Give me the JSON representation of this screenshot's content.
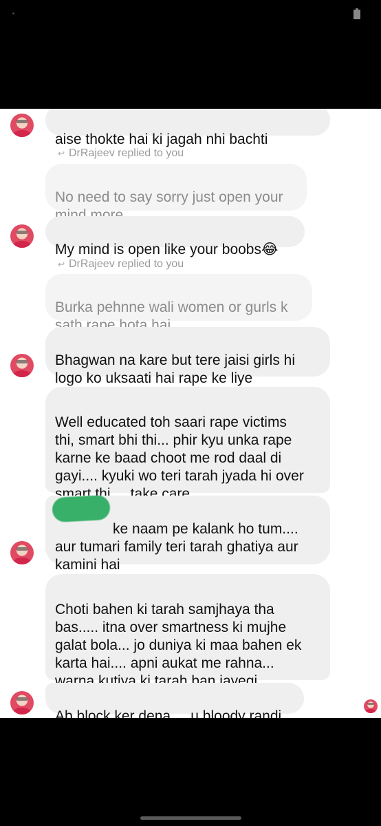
{
  "conversation": {
    "other_user": "DrRajeev",
    "reply_labels": [
      "DrRajeev replied to you",
      "DrRajeev replied to you"
    ],
    "messages": [
      {
        "from": "other",
        "text": "aise thokte hai ki jagah nhi bachti"
      },
      {
        "from": "quoted_you",
        "text": "No need to say sorry just open your\nmind more"
      },
      {
        "from": "other",
        "text": "My mind is open like your boobs😂"
      },
      {
        "from": "quoted_you",
        "text": "Burka pehnne wali women or gurls k\nsath rape hota hai"
      },
      {
        "from": "other",
        "text": "Bhagwan na kare but tere jaisi girls hi\nlogo ko uksaati hai rape ke liye"
      },
      {
        "from": "other",
        "text": "Well educated toh saari rape victims\nthi, smart bhi thi... phir kyu unka rape\nkarne ke baad choot me rod daal di\ngayi.... kyuki wo teri tarah jyada hi over\nsmart thi.... take care"
      },
      {
        "from": "other",
        "text": "ke naam pe kalank ho tum....\naur tumari family teri tarah ghatiya aur\nkamini hai",
        "redacted_prefix": true
      },
      {
        "from": "other",
        "text": "Choti bahen ki tarah samjhaya tha\nbas..... itna over smartness ki mujhe\ngalat bola... jo duniya ki maa bahen ek\nkarta hai.... apni aukat me rahna...\nwarna kutiya ki tarah ban jayegi"
      },
      {
        "from": "other",
        "text": "Ab block ker dena.... u bloody randi"
      }
    ]
  },
  "icons": {
    "reply": "reply-arrow-icon",
    "avatar": "user-avatar-icon",
    "seen": "seen-avatar-icon"
  },
  "colors": {
    "bubble": "#efefef",
    "quoted_bubble": "#f4f4f4",
    "redaction": "#38b06a"
  }
}
